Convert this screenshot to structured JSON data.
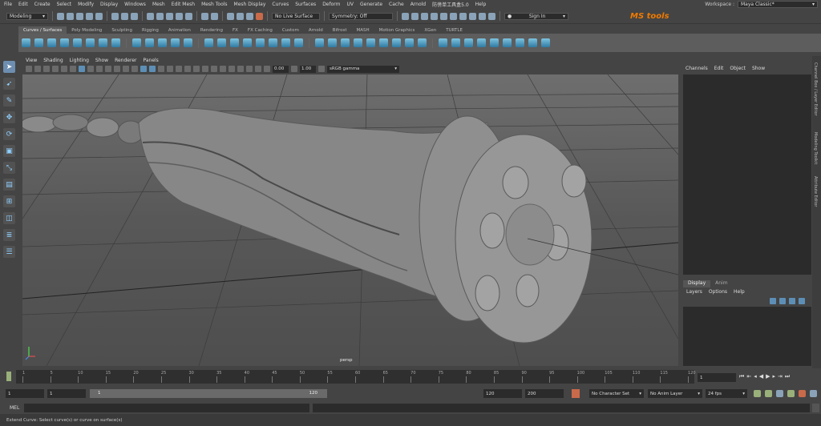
{
  "menubar": {
    "items": [
      "File",
      "Edit",
      "Create",
      "Select",
      "Modify",
      "Display",
      "Windows",
      "Mesh",
      "Edit Mesh",
      "Mesh Tools",
      "Mesh Display",
      "Curves",
      "Surfaces",
      "Deform",
      "UV",
      "Generate",
      "Cache",
      "Arnold",
      "防傍单工具盒5.0",
      "Help"
    ]
  },
  "workspace": {
    "label": "Workspace :",
    "value": "Maya Classic*"
  },
  "statusline": {
    "mode": "Modeling",
    "live_surface": "No Live Surface",
    "symmetry": "Symmetry: Off",
    "sign_in": "Sign In",
    "logo": "MS tools"
  },
  "shelf": {
    "tabs": [
      "Curves / Surfaces",
      "Poly Modeling",
      "Sculpting",
      "Rigging",
      "Animation",
      "Rendering",
      "FX",
      "FX Caching",
      "Custom",
      "Arnold",
      "Bifrost",
      "MASH",
      "Motion Graphics",
      "XGen",
      "TURTLE"
    ],
    "active_tab": "Curves / Surfaces"
  },
  "panel": {
    "menu": [
      "View",
      "Shading",
      "Lighting",
      "Show",
      "Renderer",
      "Panels"
    ],
    "exposure": "0.00",
    "gamma": "1.00",
    "colorspace": "sRGB gamma",
    "camera": "persp"
  },
  "channelbox": {
    "menu": [
      "Channels",
      "Edit",
      "Object",
      "Show"
    ],
    "layer_tabs": [
      "Display",
      "Anim"
    ],
    "layer_menu": [
      "Layers",
      "Options",
      "Help"
    ],
    "side_tabs": [
      "Channel Box / Layer Editor",
      "Modeling Toolkit",
      "Attribute Editor"
    ]
  },
  "timeline": {
    "ticks": [
      "1",
      "5",
      "10",
      "15",
      "20",
      "25",
      "30",
      "35",
      "40",
      "45",
      "50",
      "55",
      "60",
      "65",
      "70",
      "75",
      "80",
      "85",
      "90",
      "95",
      "100",
      "105",
      "110",
      "115",
      "120"
    ],
    "current_frame": "1"
  },
  "range": {
    "start": "1",
    "anim_start": "1",
    "slider_start": "1",
    "slider_end": "120",
    "end": "120",
    "anim_end": "200",
    "character_set": "No Character Set",
    "anim_layer": "No Anim Layer",
    "fps": "24 fps"
  },
  "cmdline": {
    "label": "MEL"
  },
  "helpline": {
    "text": "Extend Curve: Select curve(s) or curve on surface(s)"
  }
}
